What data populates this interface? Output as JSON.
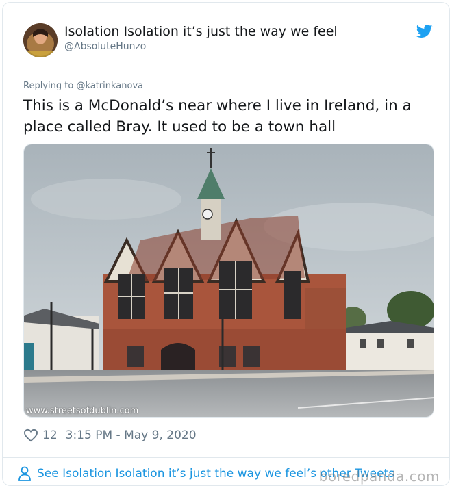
{
  "author": {
    "display_name": "Isolation Isolation it’s just the way we feel",
    "handle": "@AbsoluteHunzo"
  },
  "reply": {
    "prefix": "Replying to ",
    "to_handle": "@katrinkanova"
  },
  "tweet": {
    "text": "This is a McDonald’s near where I live in Ireland, in a place called Bray. It used to be a town hall",
    "image_watermark": "www.streetsofdublin.com"
  },
  "meta": {
    "likes": "12",
    "timestamp": "3:15 PM - May 9, 2020"
  },
  "footer": {
    "see_more": "See Isolation Isolation it’s just the way we feel’s other Tweets"
  },
  "site_watermark": "boredpanda.com",
  "icons": {
    "twitter": "twitter-bird-icon",
    "like": "heart-icon",
    "profile": "person-icon"
  },
  "colors": {
    "twitter_blue": "#1da1f2",
    "link_blue": "#1b95e0",
    "secondary_text": "#657786",
    "primary_text": "#14171a",
    "border": "#e1e8ed"
  }
}
